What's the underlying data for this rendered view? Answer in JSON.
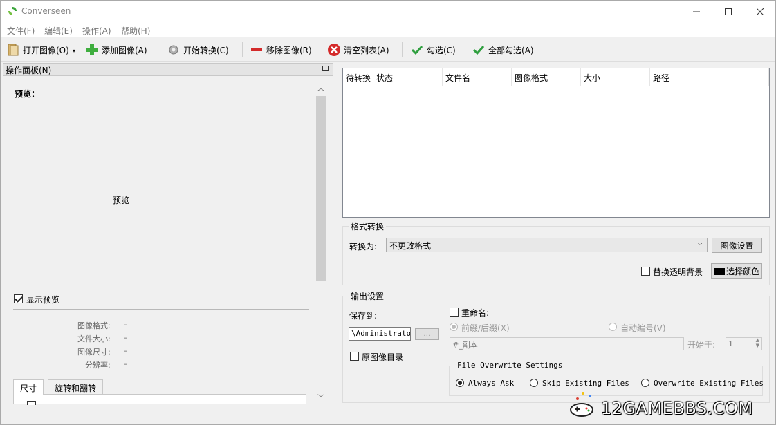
{
  "window": {
    "title": "Converseen",
    "minimize": "—",
    "maximize": "☐",
    "close": "✕"
  },
  "menu": [
    "文件(F)",
    "编辑(E)",
    "操作(A)",
    "帮助(H)"
  ],
  "toolbar": {
    "open": "打开图像(O)",
    "add": "添加图像(A)",
    "convert": "开始转换(C)",
    "remove": "移除图像(R)",
    "clear": "清空列表(A)",
    "check": "勾选(C)",
    "check_all": "全部勾选(A)"
  },
  "left": {
    "panel_title": "操作面板(N)",
    "preview_heading": "预览：",
    "preview_placeholder": "预览",
    "show_preview": "显示预览",
    "info": [
      {
        "label": "图像格式:",
        "value": "–"
      },
      {
        "label": "文件大小:",
        "value": "–"
      },
      {
        "label": "图像尺寸:",
        "value": "–"
      },
      {
        "label": "分辨率:",
        "value": "–"
      }
    ],
    "tabs": [
      "尺寸",
      "旋转和翻转"
    ]
  },
  "list": {
    "columns": [
      "待转换",
      "状态",
      "文件名",
      "图像格式",
      "大小",
      "路径"
    ]
  },
  "format": {
    "group_title": "格式转换",
    "convert_to_label": "转换为:",
    "convert_to_value": "不更改格式",
    "image_settings": "图像设置",
    "replace_transparent": "替换透明背景",
    "choose_color": "选择颜色",
    "color_swatch": "#000000"
  },
  "output": {
    "group_title": "输出设置",
    "save_to_label": "保存到:",
    "save_to_value": "\\Administrator",
    "browse": "...",
    "original_dir": "原图像目录",
    "rename": "重命名:",
    "prefix_suffix": "前缀/后缀(X)",
    "auto_number": "自动编号(V)",
    "pattern": "#_副本",
    "start_at_label": "开始于:",
    "start_at_value": "1",
    "overwrite_title": "File Overwrite Settings",
    "overwrite_options": [
      "Always Ask",
      "Skip Existing Files",
      "Overwrite Existing Files"
    ],
    "overwrite_selected": "Always Ask"
  },
  "watermark": "12GAMEBBS.COM"
}
